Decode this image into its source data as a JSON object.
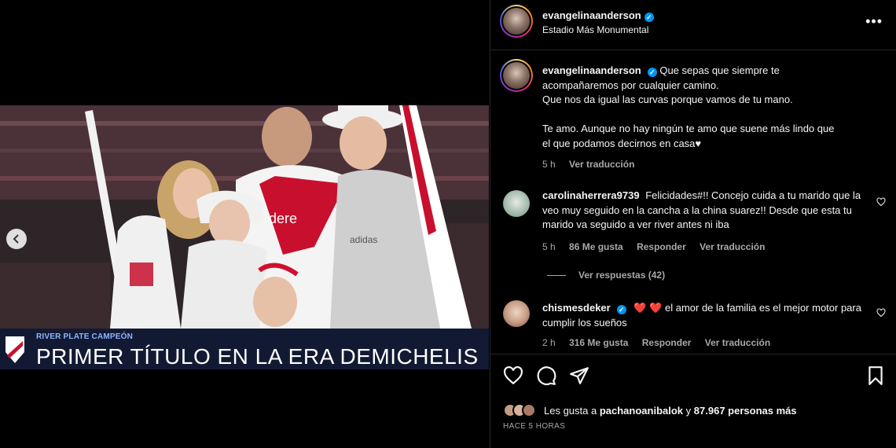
{
  "media": {
    "banner_subtitle": "RIVER PLATE CAMPEÓN",
    "banner_title": "PRIMER TÍTULO EN LA ERA DEMICHELIS",
    "jersey_text": "dere",
    "prev_icon": "chevron-left-icon"
  },
  "post": {
    "username": "evangelinaanderson",
    "location": "Estadio Más Monumental",
    "caption_lines": [
      "Que sepas que siempre te",
      "acompañaremos por cualquier camino.",
      "Que nos da igual las curvas porque vamos de tu mano.",
      "",
      "Te amo. Aunque no hay ningún te amo que suene más lindo que",
      "el que podamos decirnos en casa♥"
    ],
    "caption_time": "5 h",
    "caption_translate": "Ver traducción"
  },
  "comments": [
    {
      "username": "carolinaherrera9739",
      "text": "Felicidades#!! Concejo cuida a tu marido que la veo muy seguido en la cancha a la china suarez!! Desde que esta tu marido va seguido a ver river antes ni iba",
      "time": "5 h",
      "likes": "86 Me gusta",
      "reply": "Responder",
      "translate": "Ver traducción"
    },
    {
      "username": "chismesdeker",
      "hearts": "❤️ ❤️",
      "text": "el amor de la familia es el mejor motor para cumplir los sueños",
      "time": "2 h",
      "likes": "316 Me gusta",
      "reply": "Responder",
      "translate": "Ver traducción"
    }
  ],
  "replies_label": "Ver respuestas (42)",
  "likes": {
    "prefix": "Les gusta a",
    "user": "pachanoanibalok",
    "middle": "y",
    "count": "87.967 personas más"
  },
  "time_ago": "HACE 5 HORAS",
  "colors": {
    "verified": "#0095f6",
    "background": "#000000",
    "muted": "#a8a8a8",
    "banner": "#121a33"
  }
}
